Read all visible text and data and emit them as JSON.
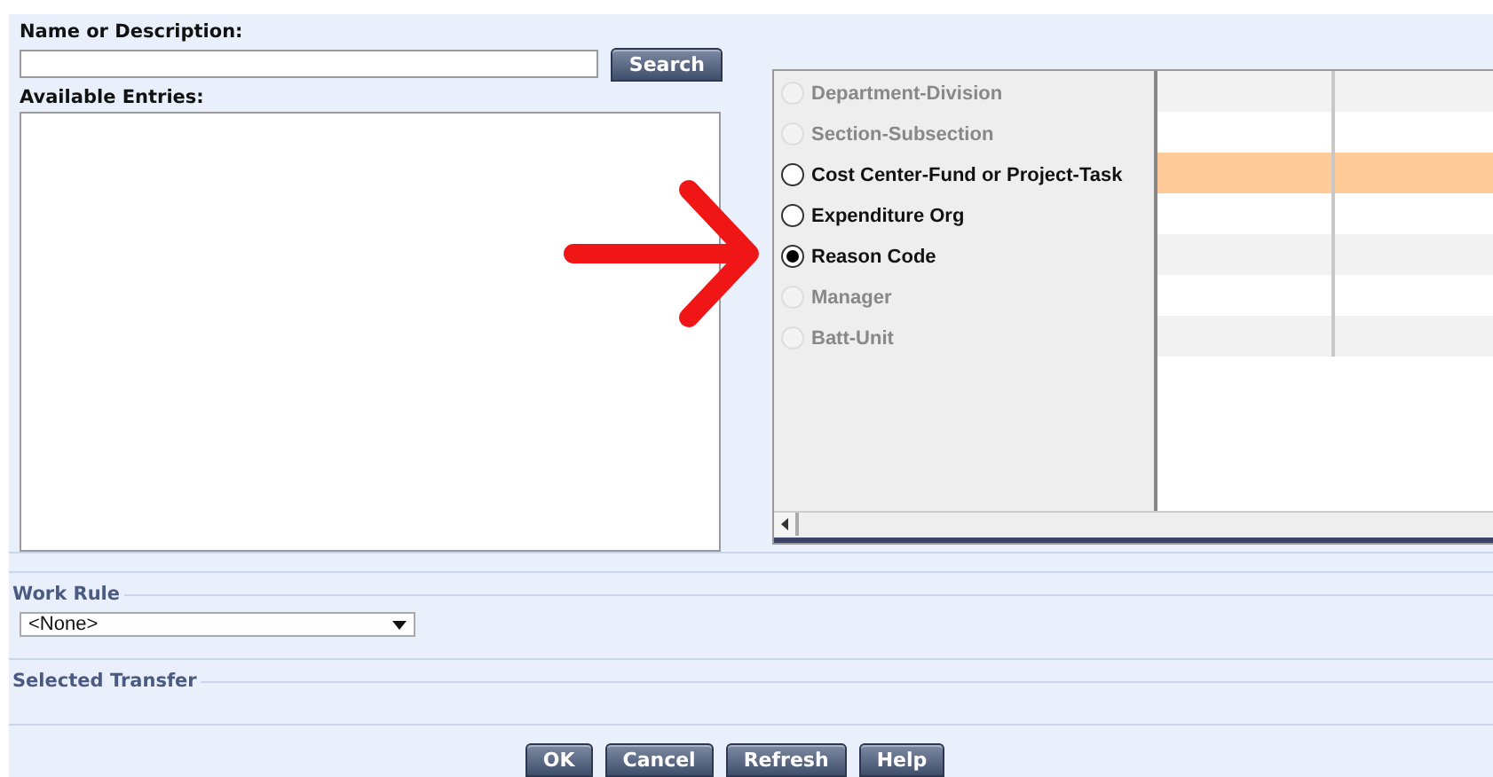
{
  "search": {
    "label": "Name or Description:",
    "button": "Search"
  },
  "entries": {
    "label": "Available Entries:"
  },
  "options": [
    {
      "label": "Department-Division",
      "disabled": true,
      "selected": false
    },
    {
      "label": "Section-Subsection",
      "disabled": true,
      "selected": false
    },
    {
      "label": "Cost Center-Fund or Project-Task",
      "disabled": false,
      "selected": false
    },
    {
      "label": "Expenditure Org",
      "disabled": false,
      "selected": false
    },
    {
      "label": "Reason Code",
      "disabled": false,
      "selected": true
    },
    {
      "label": "Manager",
      "disabled": true,
      "selected": false
    },
    {
      "label": "Batt-Unit",
      "disabled": true,
      "selected": false
    }
  ],
  "grid_rows": [
    {
      "selected": false
    },
    {
      "selected": false
    },
    {
      "selected": true
    },
    {
      "selected": false
    },
    {
      "selected": false
    },
    {
      "selected": false
    },
    {
      "selected": false
    }
  ],
  "work_rule": {
    "title": "Work Rule",
    "value": "<None>"
  },
  "selected_transfer": {
    "title": "Selected Transfer"
  },
  "buttons": [
    "OK",
    "Cancel",
    "Refresh",
    "Help"
  ]
}
